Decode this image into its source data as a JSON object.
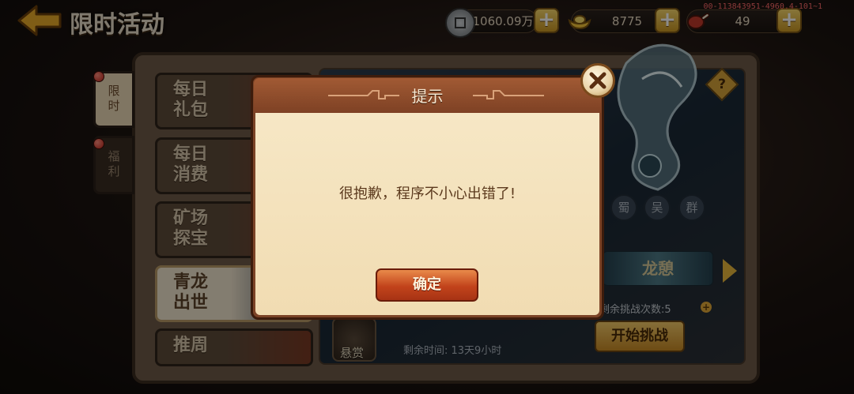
{
  "header": {
    "title": "限时活动",
    "version_id": "00-113843951-4960.4-101~1"
  },
  "resources": {
    "coins": {
      "icon": "coin-icon",
      "value": "1060.09万"
    },
    "ingots": {
      "icon": "gold-ingot-icon",
      "value": "8775"
    },
    "food": {
      "icon": "meat-icon",
      "value": "49"
    },
    "plus_label": "+"
  },
  "side_tabs": [
    {
      "label": "限时",
      "active": true
    },
    {
      "label": "福利",
      "active": false
    }
  ],
  "activities": [
    {
      "label": "每日礼包"
    },
    {
      "label": "每日消费"
    },
    {
      "label": "矿场探宝"
    },
    {
      "label": "青龙出世",
      "selected": true
    },
    {
      "label": "推周"
    }
  ],
  "event_panel": {
    "help_label": "?",
    "factions": [
      "蜀",
      "吴",
      "群"
    ],
    "boss_name": "龙憩",
    "remaining_challenges": "剩余挑战次数:5",
    "start_button": "开始挑战",
    "bounty_label": "悬赏",
    "remaining_time": "剩余时间: 13天9小时"
  },
  "dialog": {
    "title": "提示",
    "message": "很抱歉，程序不小心出错了!",
    "confirm_label": "确定",
    "close_icon": "close-icon"
  },
  "colors": {
    "dialog_frame": "#7b4326",
    "dialog_body": "#f3e1bb",
    "confirm_button": "#c2431b",
    "accent_gold": "#e8b73b"
  }
}
